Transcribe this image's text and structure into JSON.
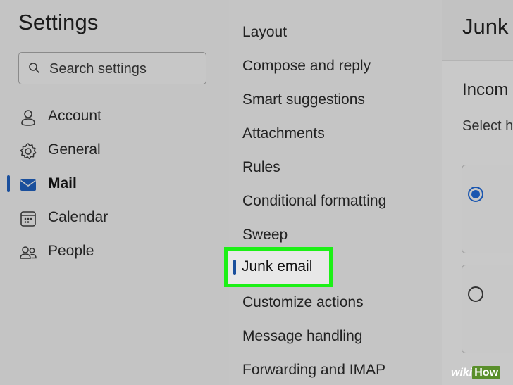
{
  "settings": {
    "title": "Settings",
    "search_placeholder": "Search settings"
  },
  "nav": {
    "items": [
      {
        "label": "Account",
        "icon": "person-icon"
      },
      {
        "label": "General",
        "icon": "gear-icon"
      },
      {
        "label": "Mail",
        "icon": "mail-icon",
        "active": true
      },
      {
        "label": "Calendar",
        "icon": "calendar-icon"
      },
      {
        "label": "People",
        "icon": "people-icon"
      }
    ]
  },
  "mail_menu": {
    "items": [
      {
        "label": "Layout"
      },
      {
        "label": "Compose and reply"
      },
      {
        "label": "Smart suggestions"
      },
      {
        "label": "Attachments"
      },
      {
        "label": "Rules"
      },
      {
        "label": "Conditional formatting"
      },
      {
        "label": "Sweep"
      },
      {
        "label": "Junk email",
        "selected": true
      },
      {
        "label": "Customize actions"
      },
      {
        "label": "Message handling"
      },
      {
        "label": "Forwarding and IMAP"
      }
    ]
  },
  "detail": {
    "title": "Junk",
    "section_heading": "Incom",
    "select_text": "Select h",
    "options": [
      {
        "checked": true
      },
      {
        "checked": false
      }
    ]
  },
  "colors": {
    "accent": "#1a4f9c",
    "highlight_border": "#1cf016",
    "background": "#c7c7c7"
  },
  "watermark": {
    "wiki": "wiki",
    "how": "How"
  }
}
